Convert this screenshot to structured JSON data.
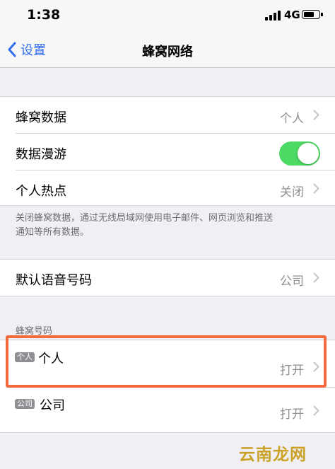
{
  "status_bar": {
    "time": "1:38",
    "network": "4G"
  },
  "nav": {
    "back_label": "设置",
    "title": "蜂窝网络"
  },
  "group1": {
    "rows": [
      {
        "label": "蜂窝数据",
        "value": "个人"
      },
      {
        "label": "数据漫游",
        "toggle_on": true
      },
      {
        "label": "个人热点",
        "value": "关闭"
      }
    ],
    "footer": [
      "关闭蜂窝数据，通过无线局域网使用电子邮件、网页浏览和推送",
      "通知等所有数据。"
    ]
  },
  "group2": {
    "rows": [
      {
        "label": "默认语音号码",
        "value": "公司"
      }
    ]
  },
  "lines_section": {
    "header": "蜂窝号码",
    "lines": [
      {
        "badge": "个人",
        "label": "个人",
        "value": "打开"
      },
      {
        "badge": "公司",
        "label": "公司",
        "value": "打开"
      }
    ]
  },
  "colors": {
    "accent": "#2f6ff0",
    "toggle_on": "#4cd964",
    "highlight": "#f26a3d",
    "watermark": "#c9a227"
  },
  "watermark": "云南龙网"
}
